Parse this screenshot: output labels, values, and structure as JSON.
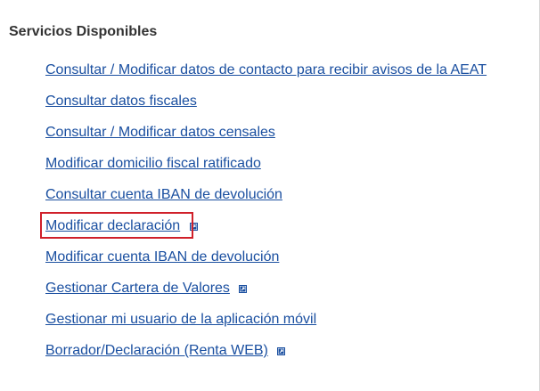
{
  "section": {
    "title": "Servicios Disponibles"
  },
  "services": [
    {
      "label": "Consultar / Modificar datos de contacto para recibir avisos de la AEAT",
      "external": false,
      "highlighted": false
    },
    {
      "label": "Consultar datos fiscales",
      "external": false,
      "highlighted": false
    },
    {
      "label": "Consultar / Modificar datos censales",
      "external": false,
      "highlighted": false
    },
    {
      "label": "Modificar domicilio fiscal ratificado",
      "external": false,
      "highlighted": false
    },
    {
      "label": "Consultar cuenta IBAN de devolución",
      "external": false,
      "highlighted": false
    },
    {
      "label": "Modificar declaración",
      "external": true,
      "highlighted": true
    },
    {
      "label": "Modificar cuenta IBAN de devolución",
      "external": false,
      "highlighted": false
    },
    {
      "label": "Gestionar Cartera de Valores",
      "external": true,
      "highlighted": false
    },
    {
      "label": "Gestionar mi usuario de la aplicación móvil",
      "external": false,
      "highlighted": false
    },
    {
      "label": "Borrador/Declaración (Renta WEB)",
      "external": true,
      "highlighted": false
    }
  ],
  "colors": {
    "link": "#1a4fa0",
    "highlight": "#d0202a",
    "title": "#333333"
  },
  "icons": {
    "external": "external-link-icon"
  }
}
